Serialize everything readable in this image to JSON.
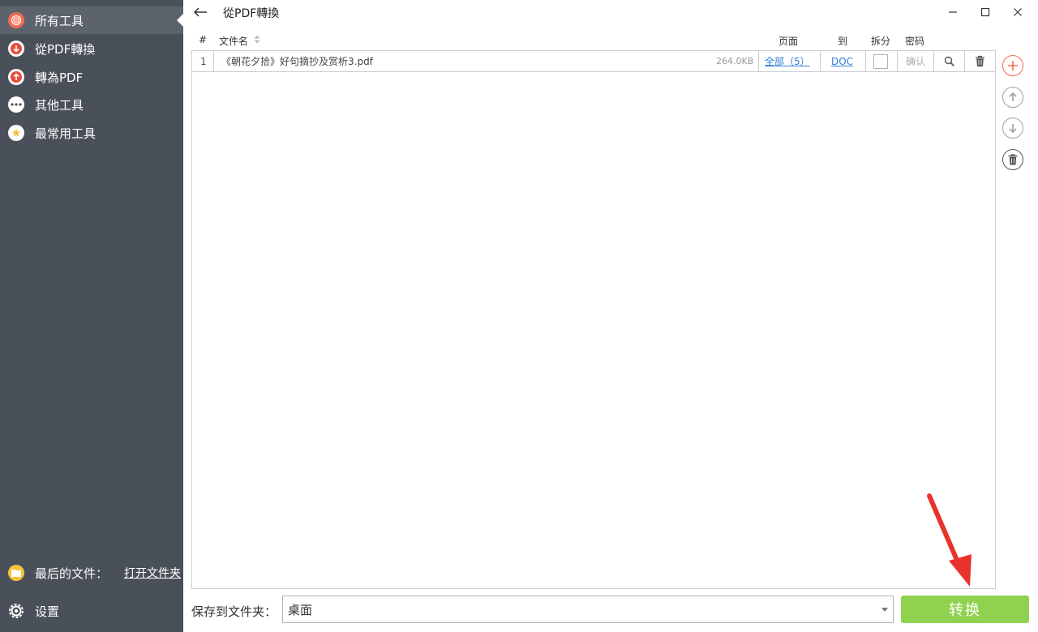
{
  "window": {
    "title": "從PDF轉換"
  },
  "sidebar": {
    "items": [
      {
        "label": "所有工具",
        "icon": "spiral-icon",
        "color": "#f26b4f",
        "active": true
      },
      {
        "label": "從PDF轉換",
        "icon": "arrow-down-icon",
        "color": "#e84c3d",
        "active": false
      },
      {
        "label": "轉為PDF",
        "icon": "arrow-up-icon",
        "color": "#e84c3d",
        "active": false
      },
      {
        "label": "其他工具",
        "icon": "ellipsis-icon",
        "color": "#ffffff",
        "active": false
      },
      {
        "label": "最常用工具",
        "icon": "star-icon",
        "color": "#ffffff",
        "active": false
      }
    ],
    "recent_label": "最后的文件：",
    "open_folder": "打开文件夹",
    "settings_label": "设置"
  },
  "table": {
    "headers": {
      "num": "#",
      "filename": "文件名",
      "pages": "页面",
      "to": "到",
      "split": "拆分",
      "password": "密码"
    },
    "rows": [
      {
        "num": "1",
        "filename": "《朝花夕拾》好句摘抄及赏析3.pdf",
        "size": "264.0KB",
        "pages": "全部（5）",
        "format": "DOC",
        "split": false,
        "password": "确认"
      }
    ]
  },
  "bottom": {
    "save_label": "保存到文件夹：",
    "folder": "桌面",
    "convert": "转换"
  },
  "colors": {
    "sidebar_bg": "#4a5059",
    "accent_green": "#8fd24f",
    "link_blue": "#2f7fd8",
    "add_red": "#f26b4f"
  }
}
